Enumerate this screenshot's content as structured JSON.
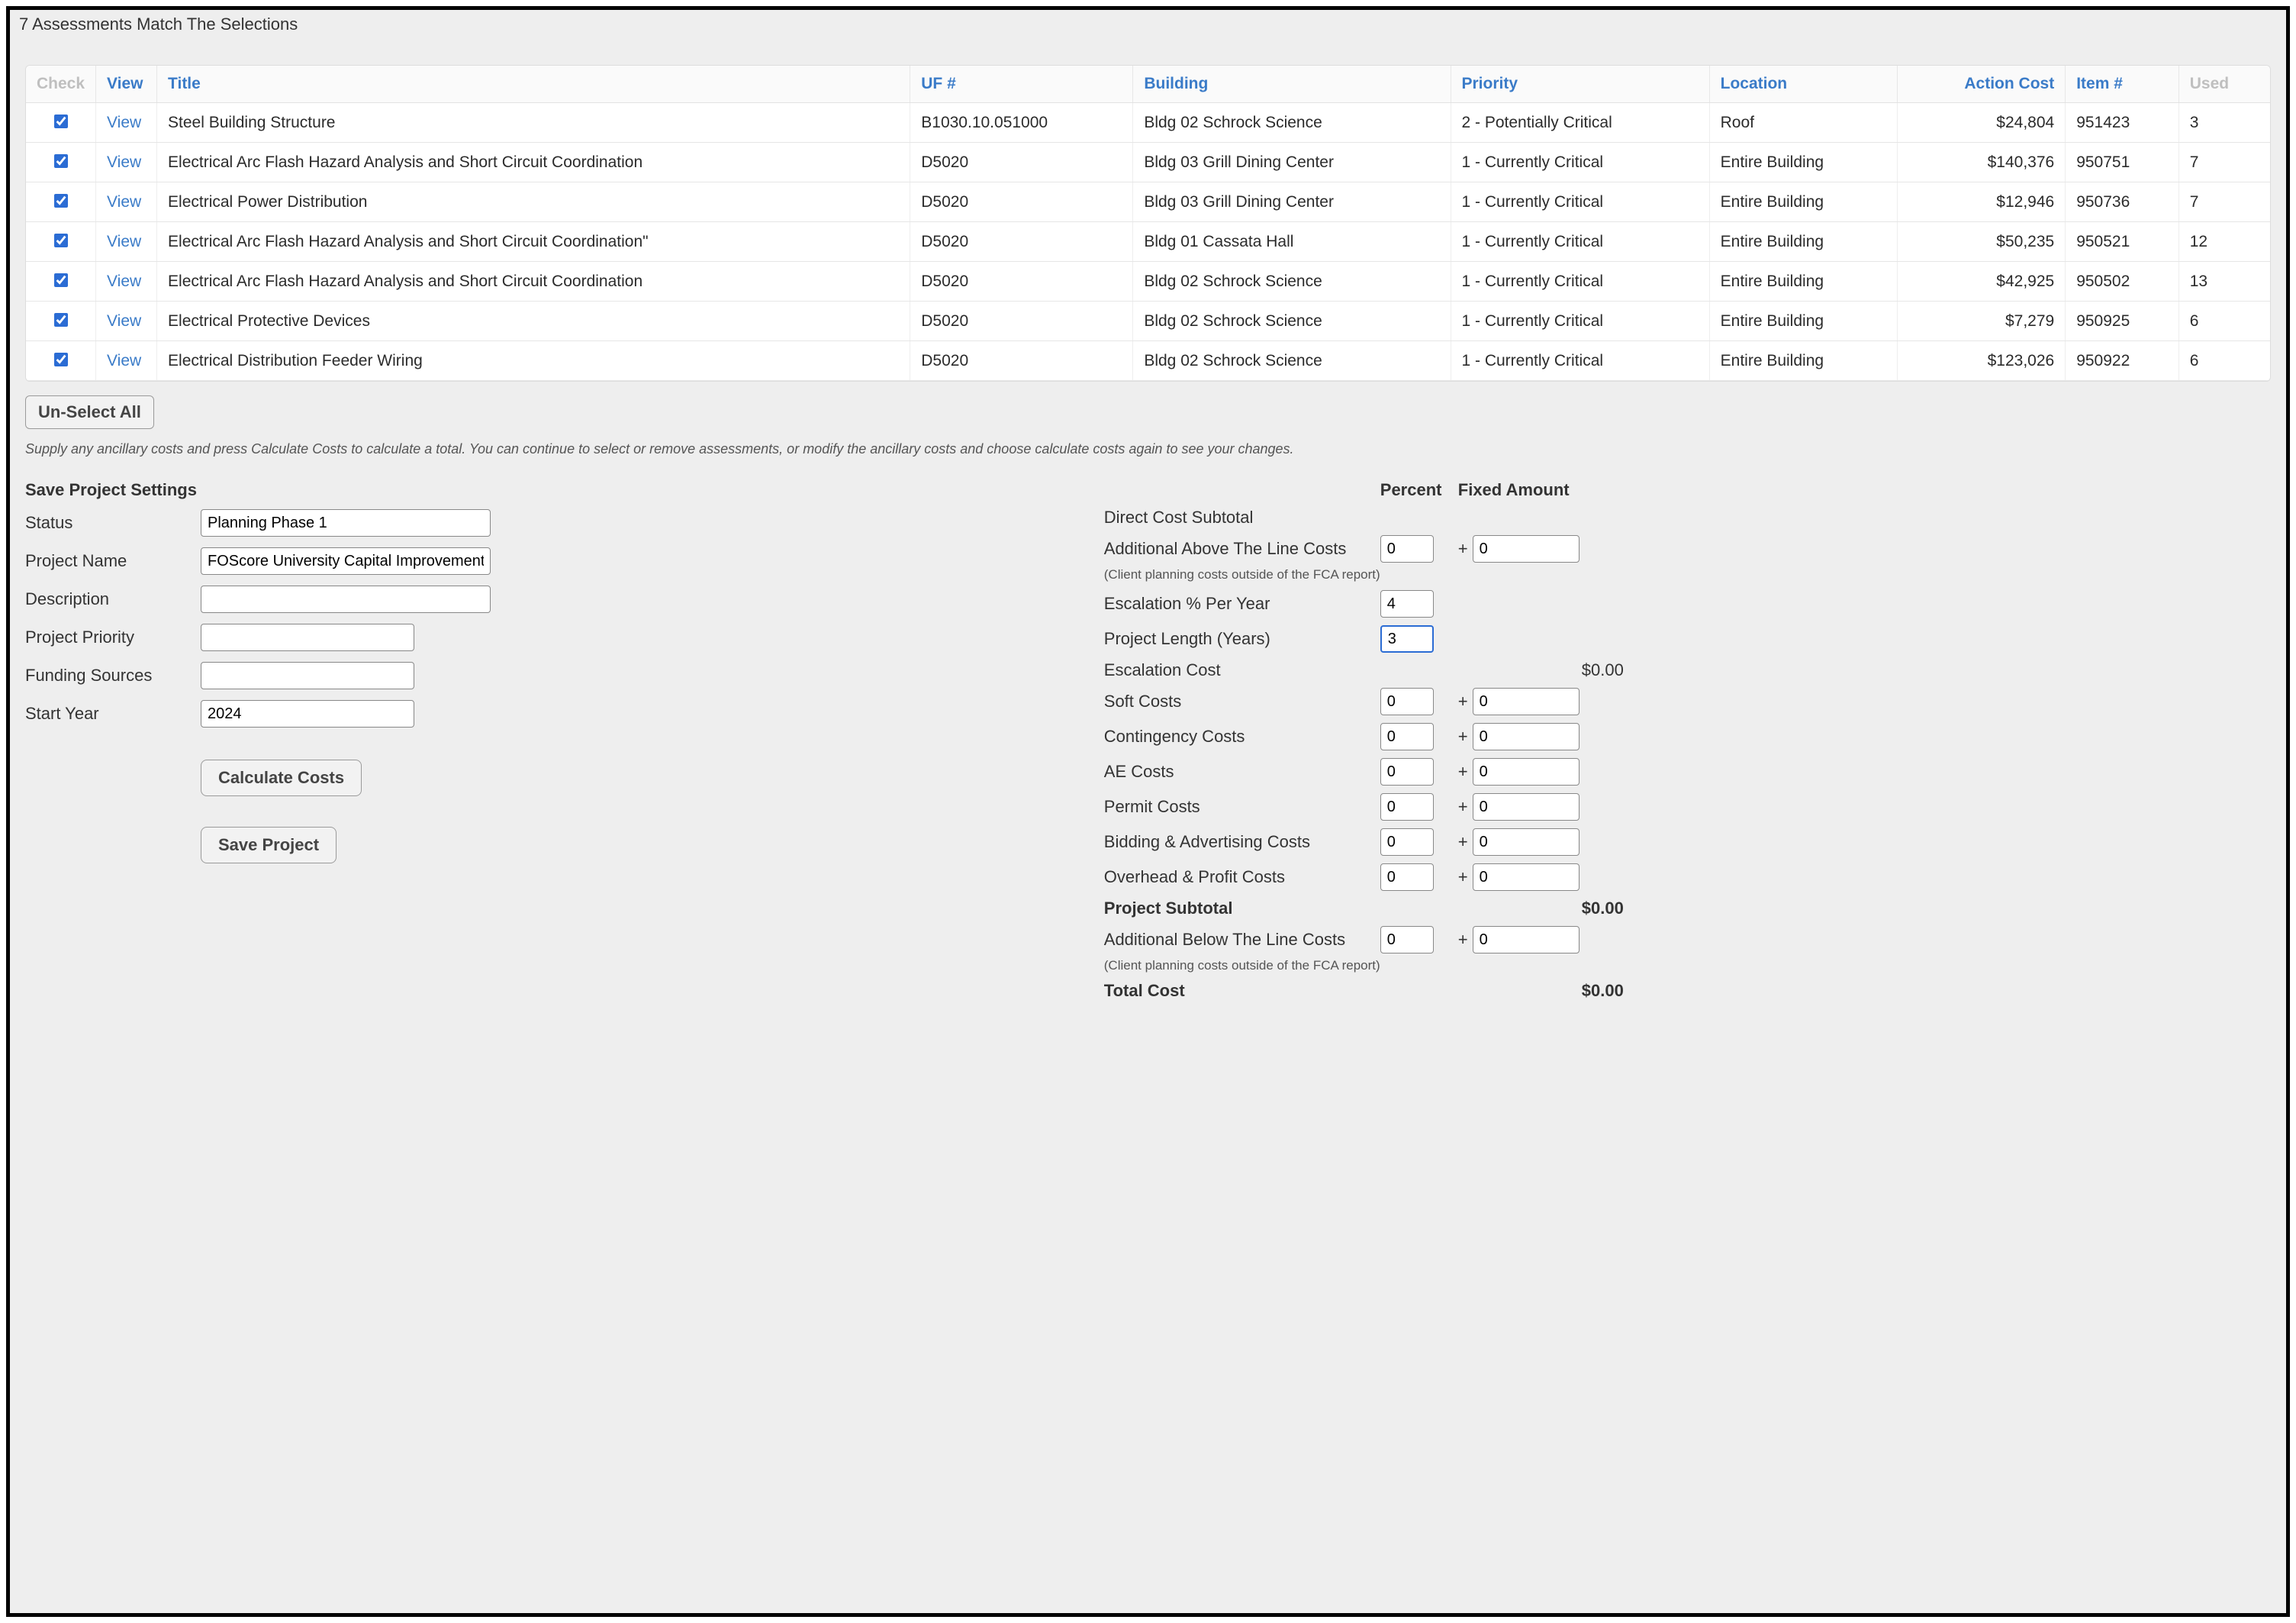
{
  "header": {
    "match_text": "7 Assessments Match The Selections"
  },
  "table": {
    "columns": {
      "check": "Check",
      "view": "View",
      "title": "Title",
      "uf": "UF #",
      "building": "Building",
      "priority": "Priority",
      "location": "Location",
      "action_cost": "Action Cost",
      "item": "Item #",
      "used": "Used"
    },
    "view_label": "View",
    "rows": [
      {
        "checked": true,
        "title": "Steel Building Structure",
        "uf": "B1030.10.051000",
        "building": "Bldg 02 Schrock Science",
        "priority": "2 - Potentially Critical",
        "location": "Roof",
        "cost": "$24,804",
        "item": "951423",
        "used": "3"
      },
      {
        "checked": true,
        "title": "Electrical Arc Flash Hazard Analysis and Short Circuit Coordination",
        "uf": "D5020",
        "building": "Bldg 03 Grill Dining Center",
        "priority": "1 - Currently Critical",
        "location": "Entire Building",
        "cost": "$140,376",
        "item": "950751",
        "used": "7"
      },
      {
        "checked": true,
        "title": "Electrical Power Distribution",
        "uf": "D5020",
        "building": "Bldg 03 Grill Dining Center",
        "priority": "1 - Currently Critical",
        "location": "Entire Building",
        "cost": "$12,946",
        "item": "950736",
        "used": "7"
      },
      {
        "checked": true,
        "title": "Electrical Arc Flash Hazard Analysis and Short Circuit Coordination\"",
        "uf": "D5020",
        "building": "Bldg 01 Cassata Hall",
        "priority": "1 - Currently Critical",
        "location": "Entire Building",
        "cost": "$50,235",
        "item": "950521",
        "used": "12"
      },
      {
        "checked": true,
        "title": "Electrical Arc Flash Hazard Analysis and Short Circuit Coordination",
        "uf": "D5020",
        "building": "Bldg 02 Schrock Science",
        "priority": "1 - Currently Critical",
        "location": "Entire Building",
        "cost": "$42,925",
        "item": "950502",
        "used": "13"
      },
      {
        "checked": true,
        "title": "Electrical Protective Devices",
        "uf": "D5020",
        "building": "Bldg 02 Schrock Science",
        "priority": "1 - Currently Critical",
        "location": "Entire Building",
        "cost": "$7,279",
        "item": "950925",
        "used": "6"
      },
      {
        "checked": true,
        "title": "Electrical Distribution Feeder Wiring",
        "uf": "D5020",
        "building": "Bldg 02 Schrock Science",
        "priority": "1 - Currently Critical",
        "location": "Entire Building",
        "cost": "$123,026",
        "item": "950922",
        "used": "6"
      }
    ]
  },
  "buttons": {
    "unselect_all": "Un-Select All",
    "calculate": "Calculate Costs",
    "save_project": "Save Project"
  },
  "hint": "Supply any ancillary costs and press Calculate Costs to calculate a total.  You can continue to select or remove assessments, or modify the ancillary costs and choose calculate costs again to see your changes.",
  "left": {
    "section_title": "Save Project Settings",
    "labels": {
      "status": "Status",
      "project_name": "Project Name",
      "description": "Description",
      "priority": "Project Priority",
      "funding": "Funding Sources",
      "start_year": "Start Year"
    },
    "values": {
      "status": "Planning Phase 1",
      "project_name": "FOScore University Capital Improvement",
      "description": "",
      "priority": "",
      "funding": "",
      "start_year": "2024"
    }
  },
  "right": {
    "headers": {
      "percent": "Percent",
      "fixed": "Fixed Amount"
    },
    "rows": {
      "direct_subtotal": {
        "label": "Direct Cost Subtotal"
      },
      "above_line": {
        "label": "Additional Above The Line Costs",
        "pct": "0",
        "amt": "0"
      },
      "above_note": "(Client planning costs outside of the FCA report)",
      "escalation_pct": {
        "label": "Escalation % Per Year",
        "pct": "4"
      },
      "project_length": {
        "label": "Project Length (Years)",
        "pct": "3"
      },
      "escalation_cost": {
        "label": "Escalation Cost",
        "value": "$0.00"
      },
      "soft": {
        "label": "Soft Costs",
        "pct": "0",
        "amt": "0"
      },
      "contingency": {
        "label": "Contingency Costs",
        "pct": "0",
        "amt": "0"
      },
      "ae": {
        "label": "AE Costs",
        "pct": "0",
        "amt": "0"
      },
      "permit": {
        "label": "Permit Costs",
        "pct": "0",
        "amt": "0"
      },
      "bidding": {
        "label": "Bidding & Advertising Costs",
        "pct": "0",
        "amt": "0"
      },
      "overhead": {
        "label": "Overhead & Profit Costs",
        "pct": "0",
        "amt": "0"
      },
      "project_subtotal": {
        "label": "Project Subtotal",
        "value": "$0.00"
      },
      "below_line": {
        "label": "Additional Below The Line Costs",
        "pct": "0",
        "amt": "0"
      },
      "below_note": "(Client planning costs outside of the FCA report)",
      "total": {
        "label": "Total Cost",
        "value": "$0.00"
      }
    }
  }
}
